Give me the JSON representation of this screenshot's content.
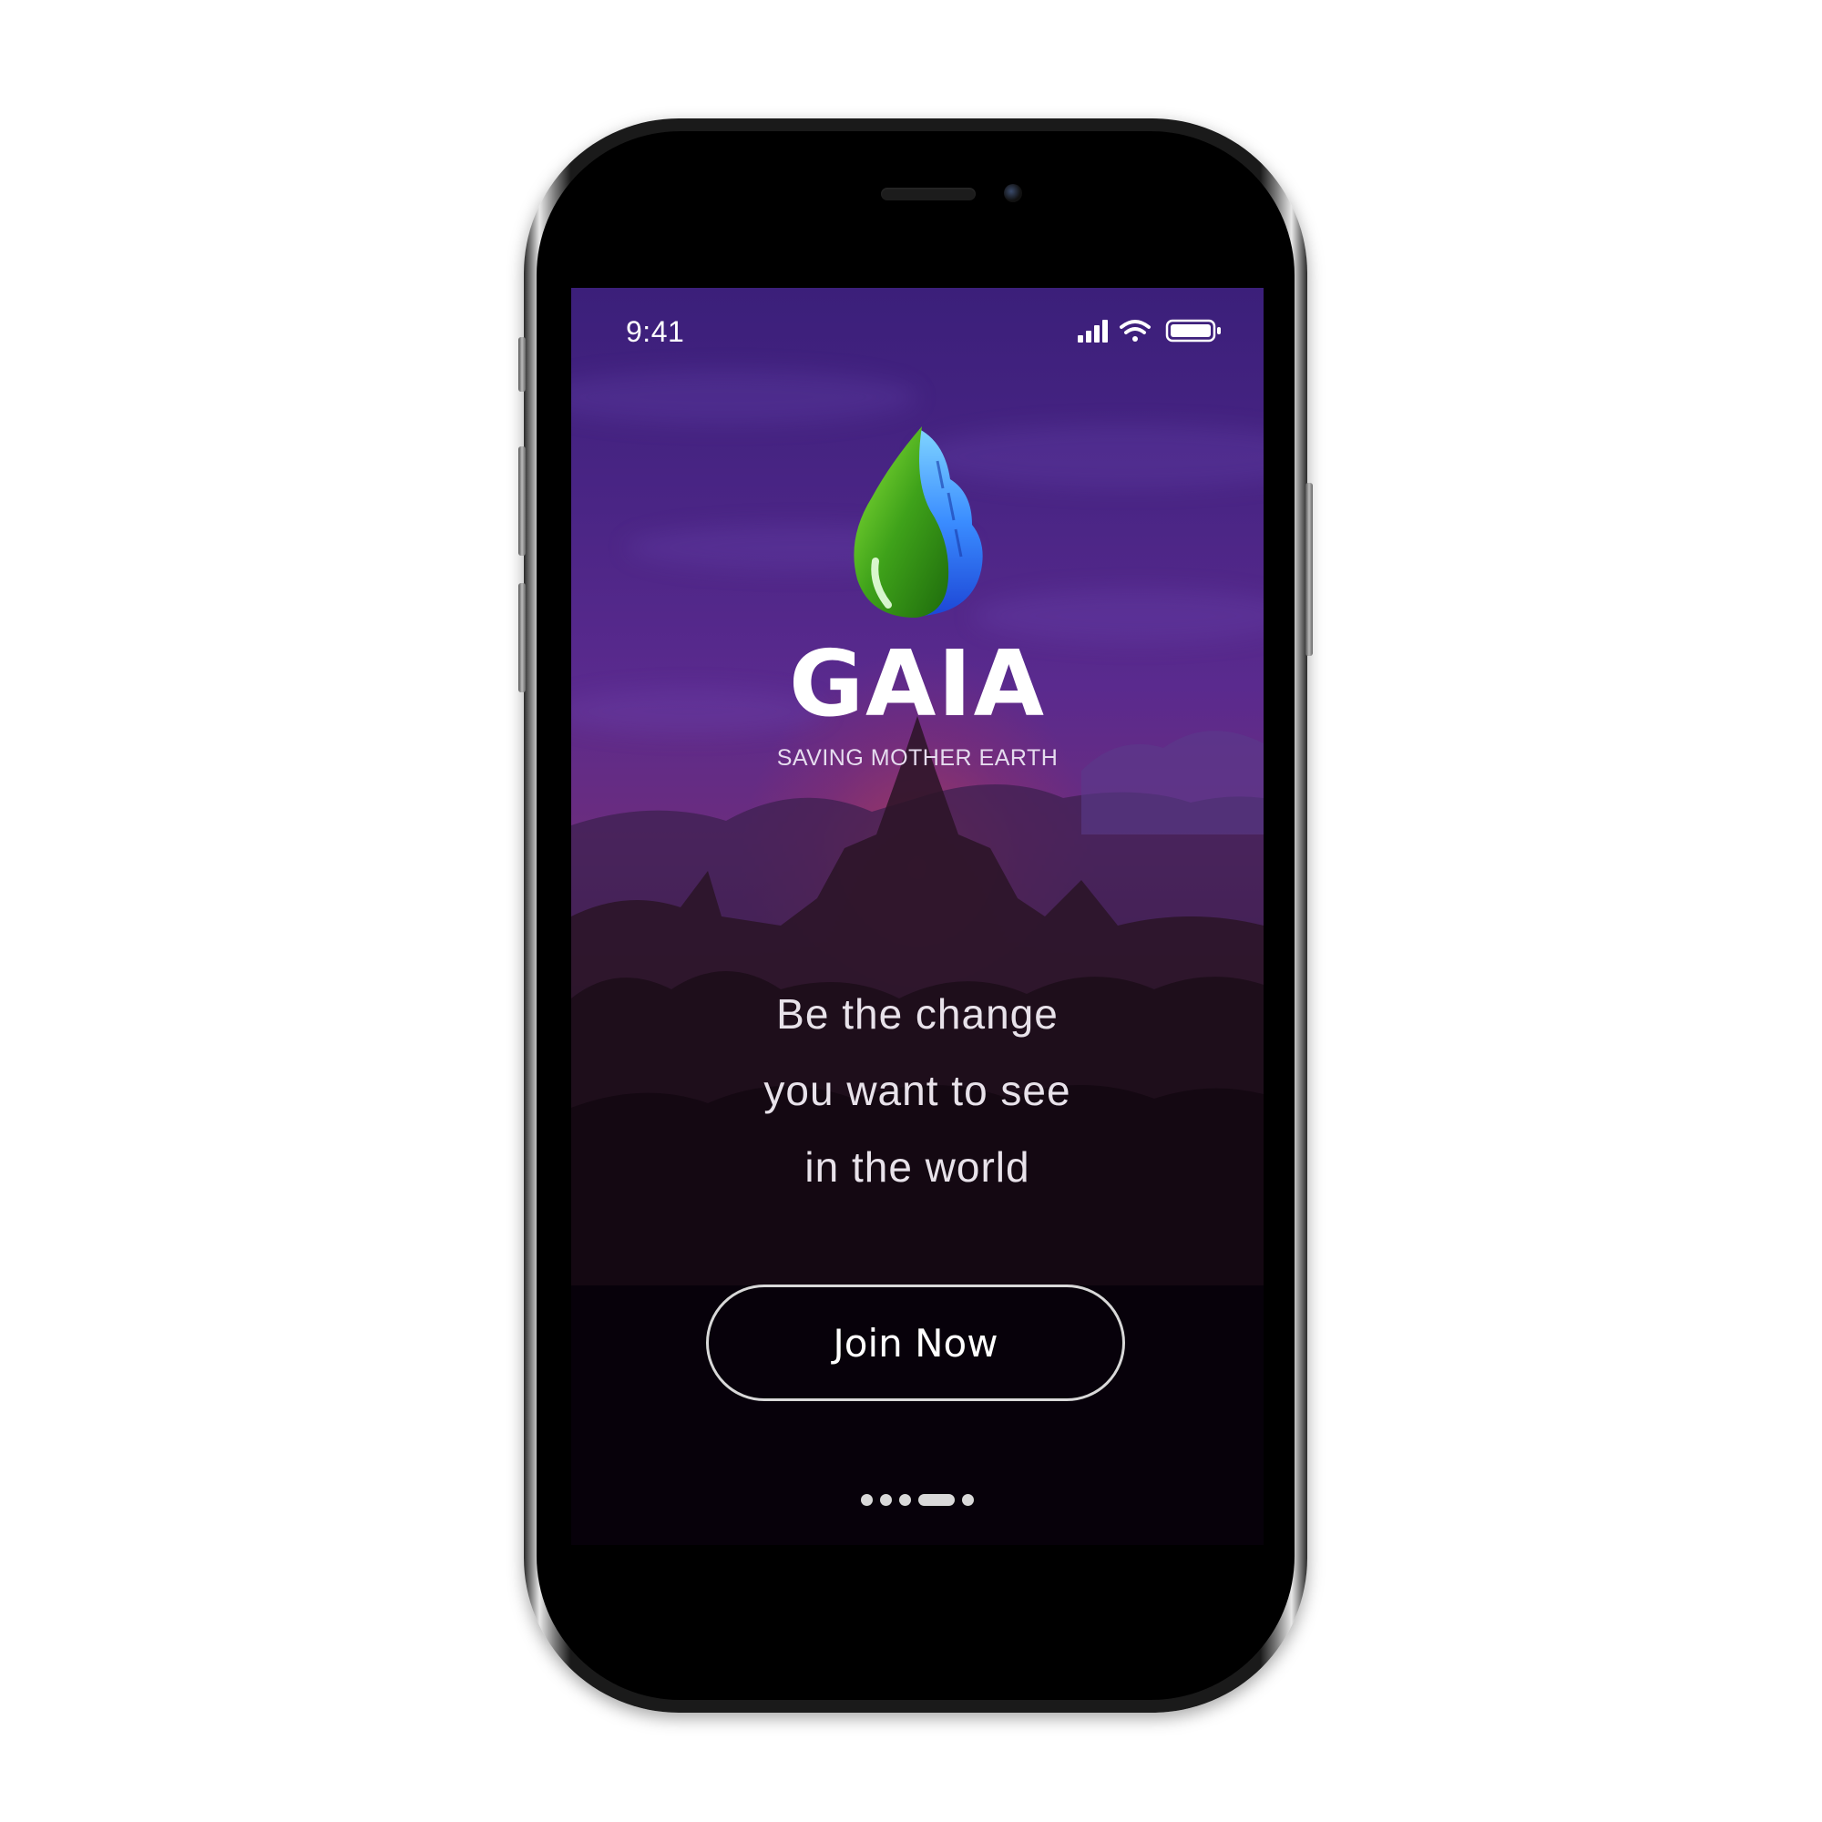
{
  "status_bar": {
    "time": "9:41",
    "icons": [
      "cellular-signal-icon",
      "wifi-icon",
      "battery-icon"
    ]
  },
  "brand": {
    "logo_icon": "leaf-flame-logo-icon",
    "name": "GAIA",
    "tagline": "SAVING MOTHER EARTH"
  },
  "motto": {
    "lines": [
      "Be the change",
      "you want to see",
      "in the world"
    ]
  },
  "cta": {
    "join_label": "Join Now"
  },
  "pager": {
    "count": 5,
    "active_index": 3
  },
  "colors": {
    "leaf_green": "#4caf1e",
    "leaf_blue": "#2f7bff",
    "sky_purple": "#4a2585",
    "button_border": "#d8d8d8"
  }
}
